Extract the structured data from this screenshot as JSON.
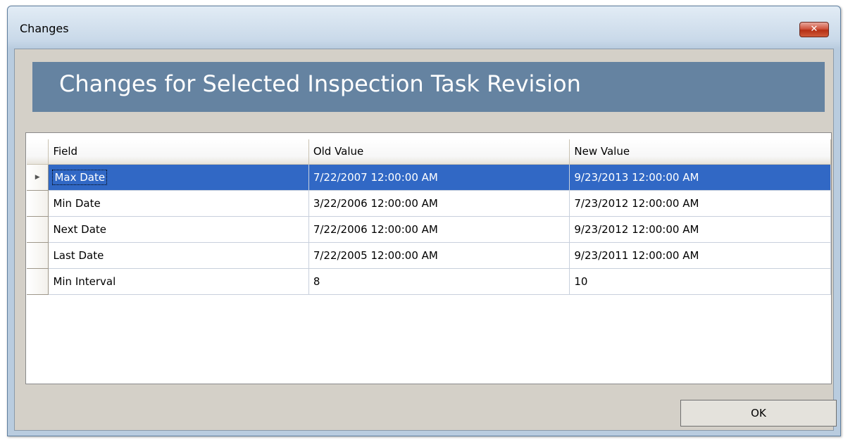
{
  "window": {
    "title": "Changes",
    "close_glyph": "✕",
    "close_icon": "close-icon"
  },
  "banner": {
    "title": "Changes for Selected Inspection Task Revision",
    "background": "#6583a1"
  },
  "grid": {
    "columns": [
      "Field",
      "Old Value",
      "New Value"
    ],
    "selected_row": 0,
    "row_indicator_glyph": "▶",
    "selection_color": "#3168c5",
    "rows": [
      {
        "field": "Max Date",
        "old": "7/22/2007 12:00:00 AM",
        "new": "9/23/2013 12:00:00 AM"
      },
      {
        "field": "Min Date",
        "old": "3/22/2006 12:00:00 AM",
        "new": "7/23/2012 12:00:00 AM"
      },
      {
        "field": "Next Date",
        "old": "7/22/2006 12:00:00 AM",
        "new": "9/23/2012 12:00:00 AM"
      },
      {
        "field": "Last Date",
        "old": "7/22/2005 12:00:00 AM",
        "new": "9/23/2011 12:00:00 AM"
      },
      {
        "field": "Min Interval",
        "old": "8",
        "new": "10"
      }
    ]
  },
  "buttons": {
    "ok_label": "OK"
  }
}
